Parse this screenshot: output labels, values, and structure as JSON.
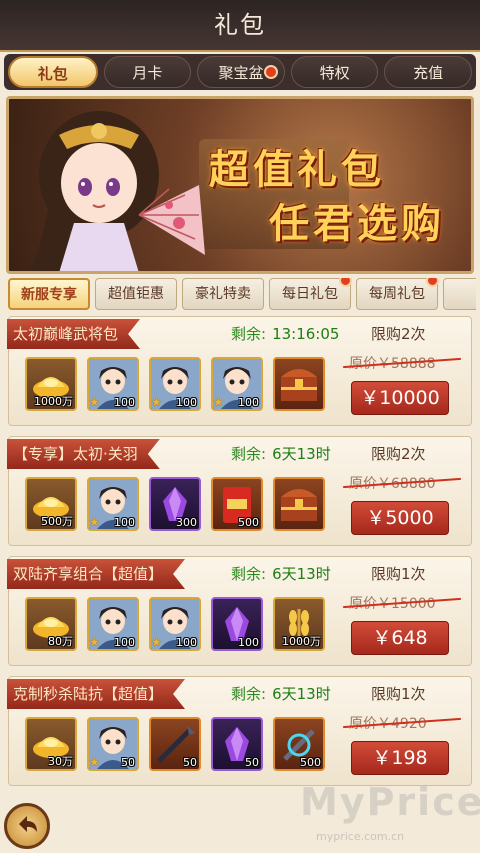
{
  "title": "礼包",
  "top_tabs": [
    {
      "label": "礼包",
      "active": true,
      "dot": false
    },
    {
      "label": "月卡",
      "active": false,
      "dot": false
    },
    {
      "label": "聚宝盆",
      "active": false,
      "dot": true
    },
    {
      "label": "特权",
      "active": false,
      "dot": false
    },
    {
      "label": "充值",
      "active": false,
      "dot": false
    }
  ],
  "banner": {
    "slogan_line1": "超值礼包",
    "slogan_line2": "任君选购"
  },
  "sub_tabs": [
    {
      "label": "新服专享",
      "active": true,
      "dot": false
    },
    {
      "label": "超值钜惠",
      "active": false,
      "dot": false
    },
    {
      "label": "豪礼特卖",
      "active": false,
      "dot": false
    },
    {
      "label": "每日礼包",
      "active": false,
      "dot": true
    },
    {
      "label": "每周礼包",
      "active": false,
      "dot": true
    },
    {
      "label": "每",
      "active": false,
      "dot": false
    }
  ],
  "remain_label": "剩余:",
  "packs": [
    {
      "name": "太初巅峰武将包",
      "remain": "13:16:05",
      "limit": "限购2次",
      "original_price": "原价￥58888",
      "price": "￥10000",
      "items": [
        {
          "icon": "gold-ingot-icon",
          "qty": "1000万",
          "frame": "gold"
        },
        {
          "icon": "hero-portrait-icon",
          "qty": "100",
          "frame": "gold",
          "star": true
        },
        {
          "icon": "hero-portrait-icon",
          "qty": "100",
          "frame": "gold",
          "star": true
        },
        {
          "icon": "hero-portrait-icon",
          "qty": "100",
          "frame": "gold",
          "star": true
        },
        {
          "icon": "treasure-chest-icon",
          "qty": "",
          "frame": "orange"
        }
      ]
    },
    {
      "name": "【专享】太初·关羽",
      "remain": "6天13时",
      "limit": "限购2次",
      "original_price": "原价￥68880",
      "price": "￥5000",
      "items": [
        {
          "icon": "gold-ingot-icon",
          "qty": "500万",
          "frame": "gold"
        },
        {
          "icon": "hero-portrait-icon",
          "qty": "100",
          "frame": "gold",
          "star": true
        },
        {
          "icon": "purple-crystal-icon",
          "qty": "300",
          "frame": "purple"
        },
        {
          "icon": "red-envelope-icon",
          "qty": "500",
          "frame": "orange"
        },
        {
          "icon": "treasure-chest-icon",
          "qty": "",
          "frame": "orange"
        }
      ]
    },
    {
      "name": "双陆齐享组合【超值】",
      "remain": "6天13时",
      "limit": "限购1次",
      "original_price": "原价￥15000",
      "price": "￥648",
      "items": [
        {
          "icon": "gold-ingot-icon",
          "qty": "80万",
          "frame": "gold"
        },
        {
          "icon": "hero-portrait-icon",
          "qty": "100",
          "frame": "gold",
          "star": true
        },
        {
          "icon": "hero-portrait-icon",
          "qty": "100",
          "frame": "gold",
          "star": true
        },
        {
          "icon": "purple-crystal-icon",
          "qty": "100",
          "frame": "purple"
        },
        {
          "icon": "wheat-icon",
          "qty": "1000万",
          "frame": "gold"
        }
      ]
    },
    {
      "name": "克制秒杀陆抗【超值】",
      "remain": "6天13时",
      "limit": "限购1次",
      "original_price": "原价￥4920",
      "price": "￥198",
      "items": [
        {
          "icon": "gold-ingot-icon",
          "qty": "30万",
          "frame": "gold"
        },
        {
          "icon": "hero-portrait-icon",
          "qty": "50",
          "frame": "gold",
          "star": true
        },
        {
          "icon": "weapon-icon",
          "qty": "50",
          "frame": "orange"
        },
        {
          "icon": "purple-crystal-icon",
          "qty": "50",
          "frame": "purple"
        },
        {
          "icon": "artifact-icon",
          "qty": "500",
          "frame": "orange"
        }
      ]
    }
  ],
  "watermark": "MyPrice",
  "watermark_url": "myprice.com.cn"
}
